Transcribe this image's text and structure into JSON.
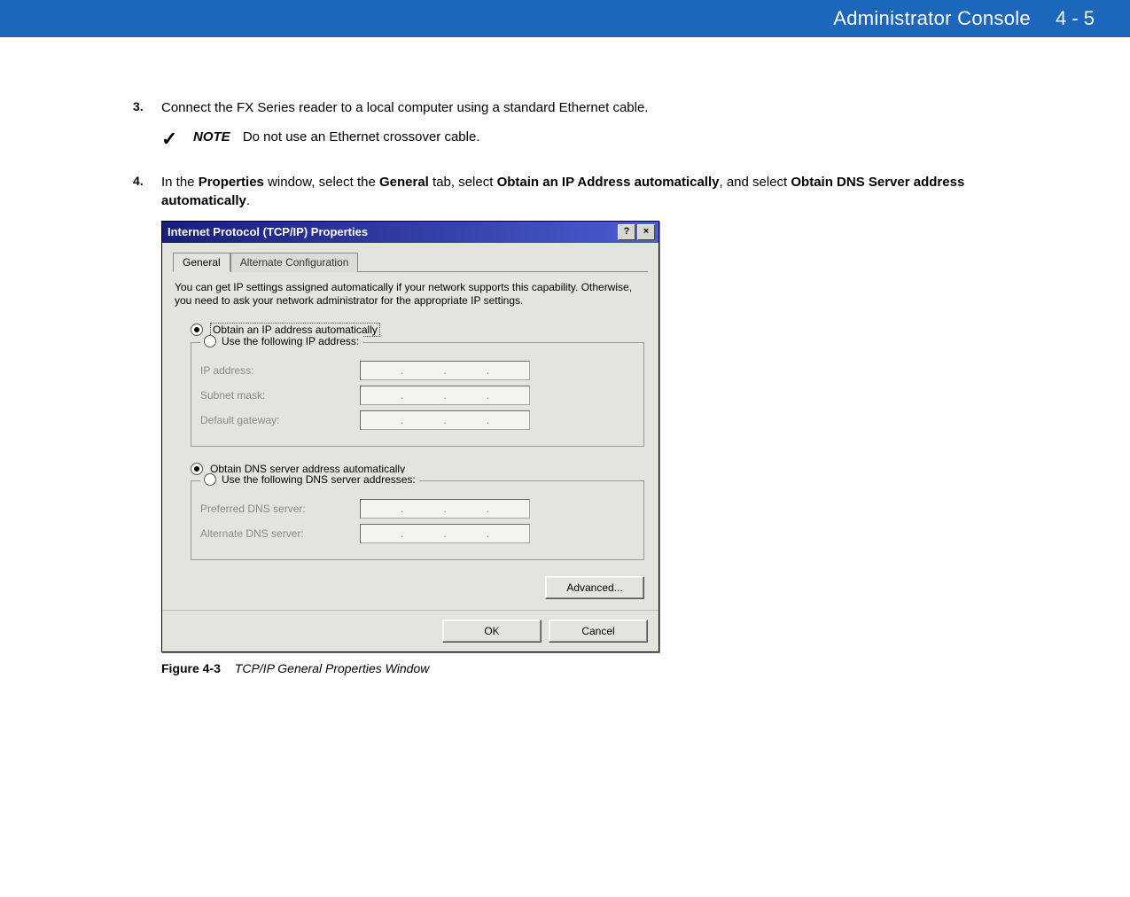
{
  "header": {
    "title": "Administrator Console",
    "page": "4 - 5"
  },
  "steps": {
    "s3": {
      "num": "3.",
      "text": "Connect the FX Series reader to a local computer using a standard Ethernet cable."
    },
    "s4": {
      "num": "4.",
      "pre": "In the ",
      "b1": "Properties",
      "mid1": " window, select the ",
      "b2": "General",
      "mid2": " tab, select ",
      "b3": "Obtain an IP Address automatically",
      "mid3": ", and select ",
      "b4": "Obtain DNS Server address automatically",
      "post": "."
    }
  },
  "note": {
    "label": "NOTE",
    "text": "Do not use an Ethernet crossover cable."
  },
  "dialog": {
    "title": "Internet Protocol (TCP/IP) Properties",
    "help_btn": "?",
    "close_btn": "×",
    "tabs": {
      "general": "General",
      "alt": "Alternate Configuration"
    },
    "desc": "You can get IP settings assigned automatically if your network supports this capability. Otherwise, you need to ask your network administrator for the appropriate IP settings.",
    "ip_auto": "Obtain an IP address automatically",
    "ip_manual": "Use the following IP address:",
    "ip_addr": "IP address:",
    "subnet": "Subnet mask:",
    "gateway": "Default gateway:",
    "dns_auto": "Obtain DNS server address automatically",
    "dns_manual": "Use the following DNS server addresses:",
    "pref_dns": "Preferred DNS server:",
    "alt_dns": "Alternate DNS server:",
    "advanced": "Advanced...",
    "ok": "OK",
    "cancel": "Cancel"
  },
  "figure": {
    "label": "Figure 4-3",
    "title": "TCP/IP General Properties Window"
  }
}
